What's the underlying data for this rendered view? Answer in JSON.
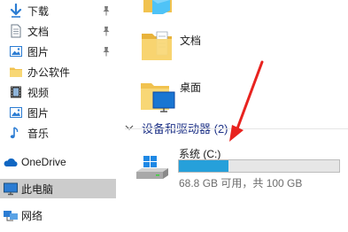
{
  "nav": {
    "items": [
      {
        "label": "下载",
        "icon": "download-arrow-icon",
        "pinned": true
      },
      {
        "label": "文档",
        "icon": "document-icon",
        "pinned": true
      },
      {
        "label": "图片",
        "icon": "pictures-icon",
        "pinned": true
      },
      {
        "label": "办公软件",
        "icon": "folder-icon",
        "pinned": false
      },
      {
        "label": "视频",
        "icon": "film-icon",
        "pinned": false
      },
      {
        "label": "图片",
        "icon": "pictures-icon",
        "pinned": false
      },
      {
        "label": "音乐",
        "icon": "music-note-icon",
        "pinned": false
      },
      {
        "label": "OneDrive",
        "icon": "cloud-icon",
        "pinned": false
      },
      {
        "label": "此电脑",
        "icon": "this-pc-icon",
        "pinned": false,
        "selected": true
      },
      {
        "label": "网络",
        "icon": "network-icon",
        "pinned": false
      }
    ]
  },
  "content": {
    "folders": [
      {
        "label": "文档",
        "icon": "documents-folder-icon"
      },
      {
        "label": "桌面",
        "icon": "desktop-folder-icon"
      }
    ],
    "group": {
      "label": "设备和驱动器 (2)"
    },
    "drive": {
      "label": "系统 (C:)",
      "detail": "68.8 GB 可用，共 100 GB",
      "used_fraction": 0.312
    }
  },
  "colors": {
    "accent": "#26a0da",
    "folder": "#f1c24f",
    "selected_bg": "#cccccc",
    "annotation_arrow": "#e8231f",
    "group_header": "#1e3287"
  }
}
